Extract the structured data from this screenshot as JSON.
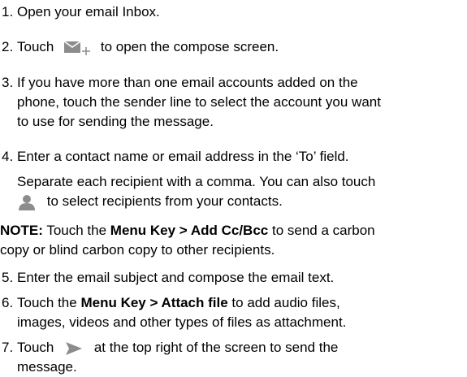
{
  "steps": [
    {
      "num": "1.",
      "text": "Open your email Inbox."
    },
    {
      "num": "2.",
      "pre": "Touch",
      "post": "to open the compose screen.",
      "icon": "compose-mail-icon"
    },
    {
      "num": "3.",
      "lines": [
        "If you have more than one email accounts added on the",
        "phone, touch the sender line to select the account you want",
        "to use for sending the message."
      ]
    },
    {
      "num": "4.",
      "text": "Enter a contact name or email address in the ‘To’ field.",
      "sub1": "Separate each recipient with a comma. You can also touch",
      "sub2": "to select recipients from your contacts.",
      "icon": "contacts-person-icon"
    },
    {
      "num": "5.",
      "text": "Enter the email subject and compose the email text."
    },
    {
      "num": "6.",
      "pre": "Touch the",
      "bold": "Menu Key > Attach file",
      "post": "to add audio files,",
      "line2": "images, videos and other types of files as attachment."
    },
    {
      "num": "7.",
      "pre": "Touch",
      "post": "at the top right of the screen to send the",
      "line2": "message.",
      "icon": "send-icon"
    }
  ],
  "note": {
    "label": "NOTE:",
    "pre": "Touch the",
    "bold": "Menu Key > Add Cc/Bcc",
    "post": "to send a carbon",
    "line2": "copy or blind carbon copy to other recipients."
  },
  "colors": {
    "icon_gray": "#8c8c8c",
    "text": "#000000"
  }
}
